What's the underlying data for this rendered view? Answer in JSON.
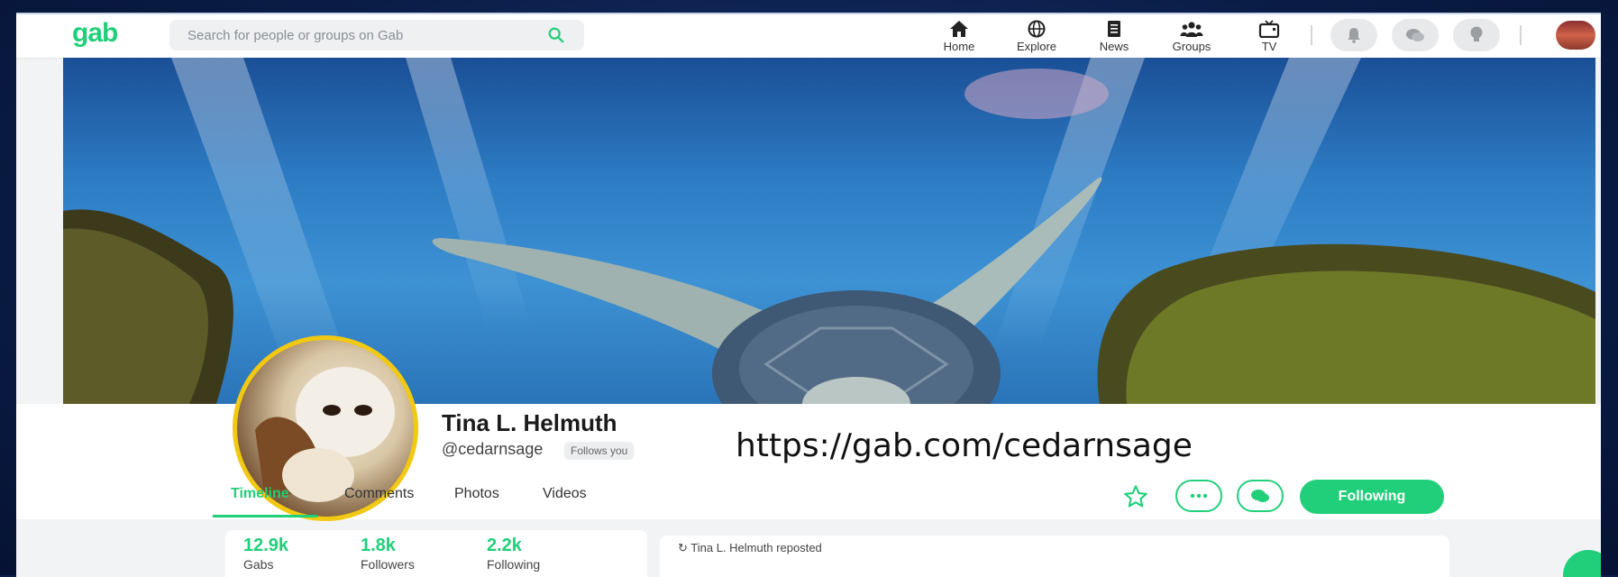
{
  "brand": {
    "logo": "gab",
    "accent": "#21cf7a"
  },
  "search": {
    "placeholder": "Search for people or groups on Gab"
  },
  "nav": {
    "items": [
      {
        "label": "Home",
        "icon": "home-icon"
      },
      {
        "label": "Explore",
        "icon": "globe-icon"
      },
      {
        "label": "News",
        "icon": "news-icon"
      },
      {
        "label": "Groups",
        "icon": "groups-icon"
      },
      {
        "label": "TV",
        "icon": "tv-icon"
      }
    ],
    "actions": [
      "bell-icon",
      "chat-icon",
      "lightbulb-icon"
    ]
  },
  "profile": {
    "name": "Tina L. Helmuth",
    "handle": "@cedarnsage",
    "follows_you": "Follows you",
    "url_overlay": "https://gab.com/cedarnsage"
  },
  "tabs": [
    {
      "label": "Timeline",
      "active": true
    },
    {
      "label": "Comments",
      "active": false
    },
    {
      "label": "Photos",
      "active": false
    },
    {
      "label": "Videos",
      "active": false
    }
  ],
  "actions": {
    "following_label": "Following"
  },
  "stats": [
    {
      "value": "12.9k",
      "label": "Gabs"
    },
    {
      "value": "1.8k",
      "label": "Followers"
    },
    {
      "value": "2.2k",
      "label": "Following"
    }
  ],
  "feed": {
    "repost_text": "Tina L. Helmuth reposted"
  }
}
